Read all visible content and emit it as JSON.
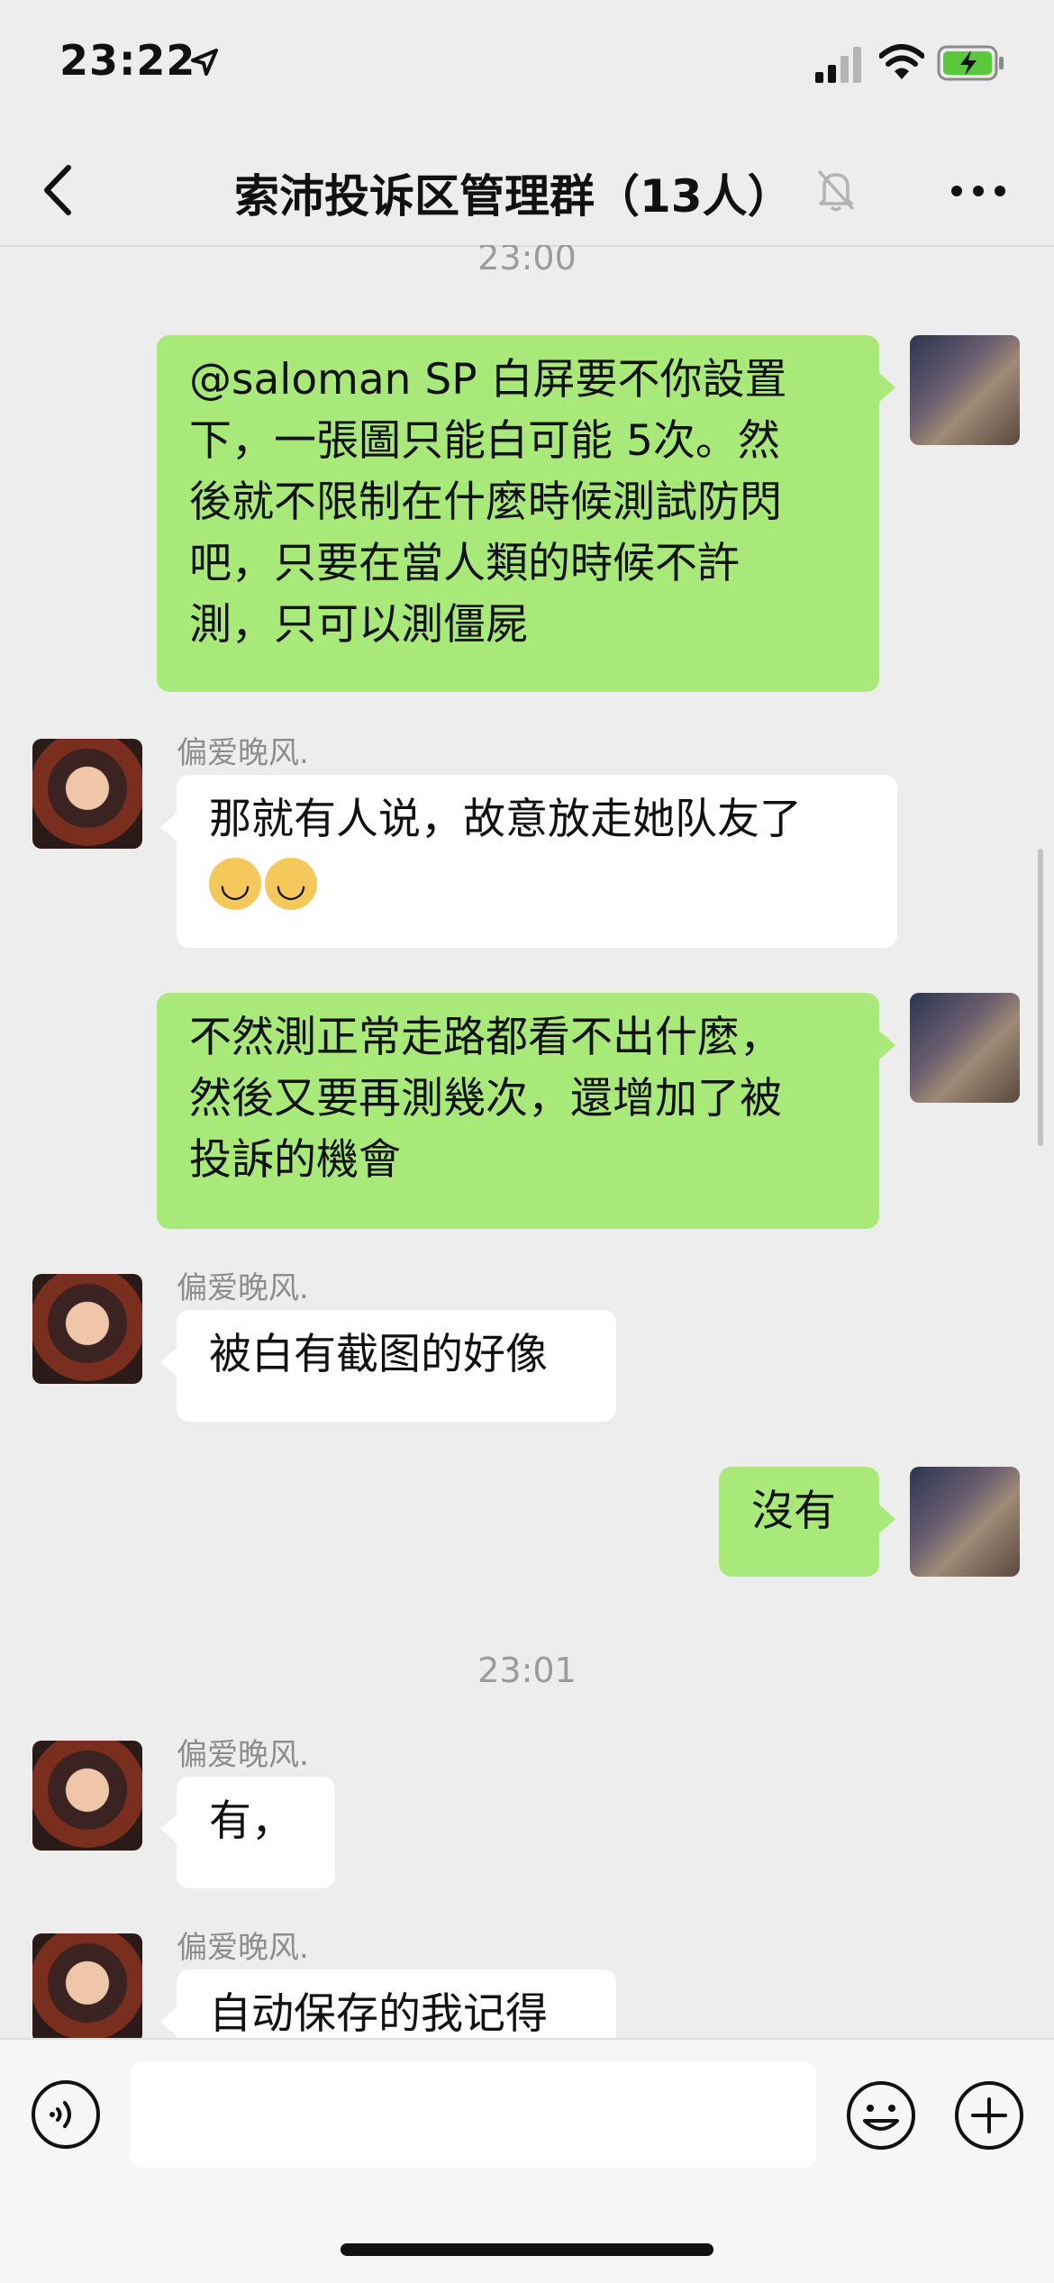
{
  "status_bar": {
    "time": "23:22"
  },
  "nav": {
    "title": "索沛投诉区管理群（13人）"
  },
  "chat": {
    "timestamps": [
      "23:00",
      "23:01"
    ],
    "messages": [
      {
        "from": "me",
        "lines": [
          "@saloman SP 白屏要不你設置",
          "下，一張圖只能白可能 5次。然",
          "後就不限制在什麼時候測試防閃",
          "吧，只要在當人類的時候不許",
          "測，只可以測僵屍"
        ]
      },
      {
        "from": "other",
        "sender": "偏爱晚风.",
        "lines": [
          "那就有人说，故意放走她队友了"
        ],
        "emojis": [
          "doge-emoji",
          "doge-emoji"
        ]
      },
      {
        "from": "me",
        "lines": [
          "不然測正常走路都看不出什麼，",
          "然後又要再測幾次，還增加了被",
          "投訴的機會"
        ]
      },
      {
        "from": "other",
        "sender": "偏爱晚风.",
        "lines": [
          "被白有截图的好像"
        ]
      },
      {
        "from": "me",
        "lines": [
          "沒有"
        ]
      },
      {
        "from": "other",
        "sender": "偏爱晚风.",
        "lines": [
          "有，"
        ]
      },
      {
        "from": "other",
        "sender": "偏爱晚风.",
        "lines": [
          "自动保存的我记得"
        ]
      }
    ]
  },
  "colors": {
    "me_bubble": "#a9e97a",
    "other_bubble": "#ffffff",
    "background": "#ededed"
  }
}
